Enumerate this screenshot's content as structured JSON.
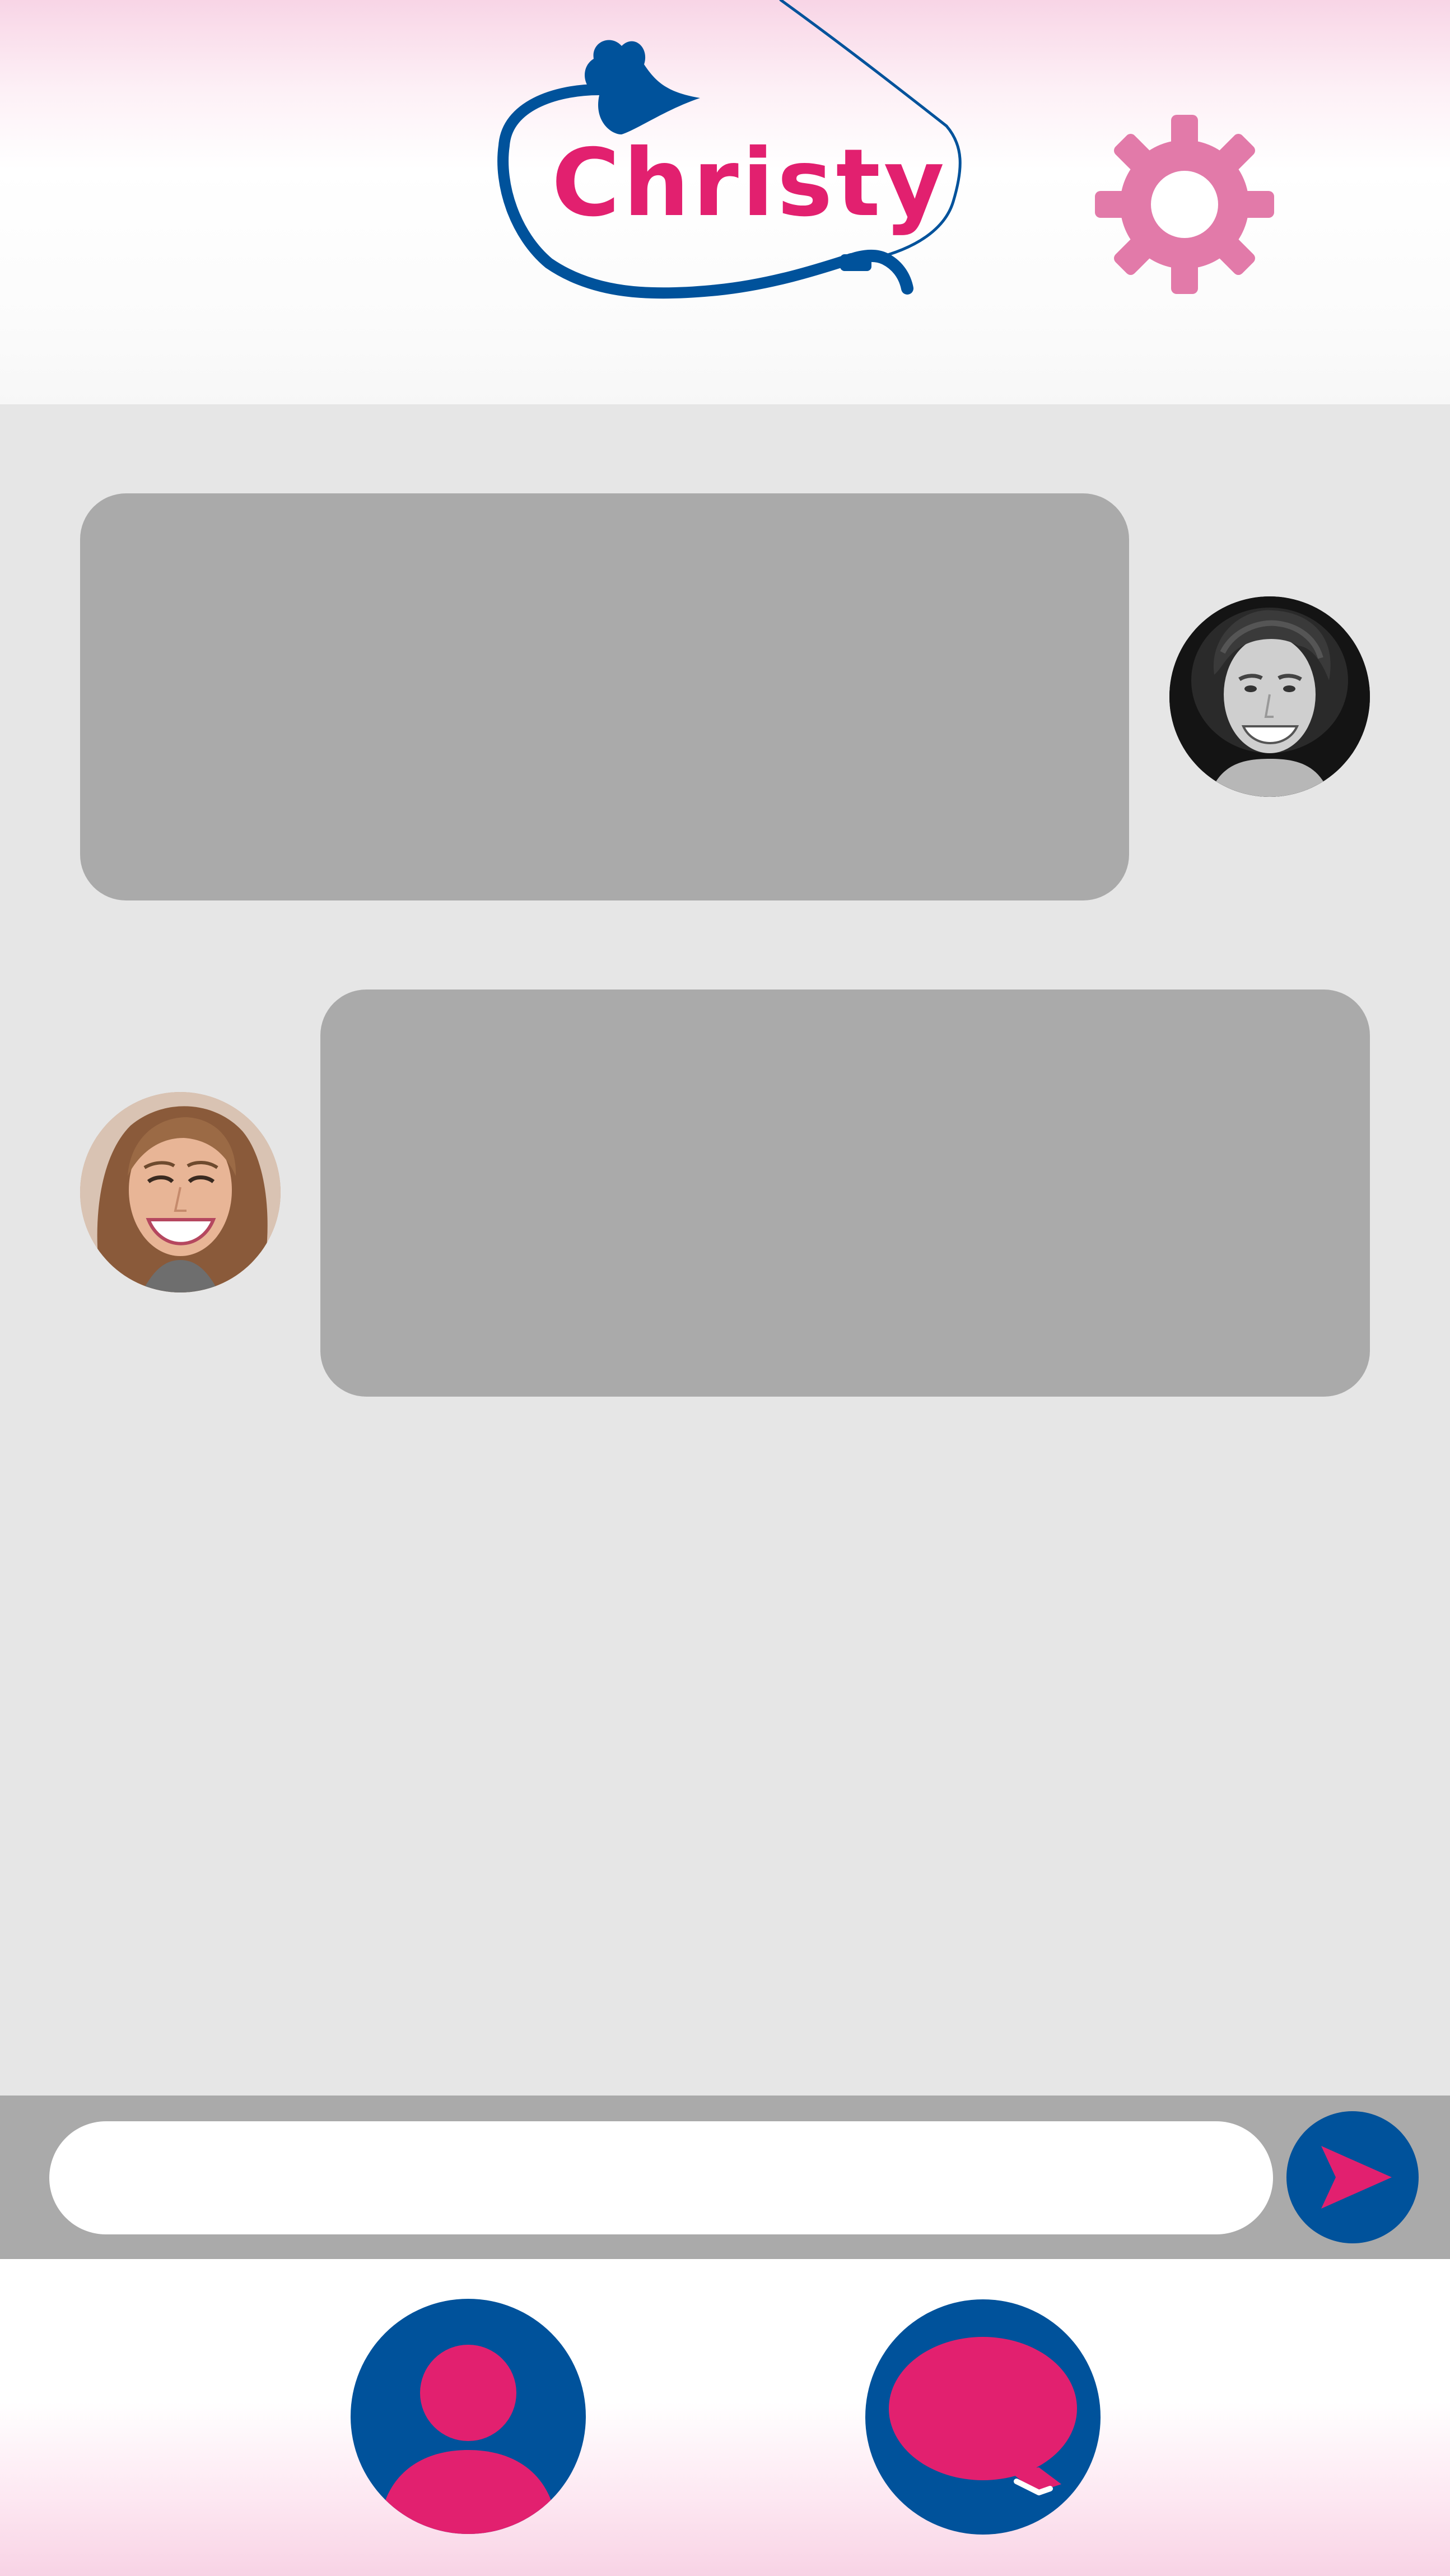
{
  "app": {
    "title": "Christy"
  },
  "header": {
    "logo_text": "Christy",
    "logo_icon": "heart-leash-icon",
    "settings_icon": "gear-icon"
  },
  "chat": {
    "messages": [
      {
        "side": "left-bubble-right-avatar",
        "text": "",
        "avatar": "smiling-man-avatar"
      },
      {
        "side": "right-bubble-left-avatar",
        "text": "",
        "avatar": "smiling-woman-avatar"
      }
    ]
  },
  "composer": {
    "input_value": "",
    "placeholder": "",
    "send_icon": "send-arrow-icon"
  },
  "bottom_nav": {
    "items": [
      {
        "icon": "profile-icon"
      },
      {
        "icon": "chat-bubble-icon"
      }
    ]
  },
  "colors": {
    "brand_pink": "#e2206f",
    "brand_blue": "#00529b",
    "settings_pink": "#e27aa9",
    "bubble_gray": "#aaaaaa",
    "chat_background": "#e6e6e6"
  }
}
